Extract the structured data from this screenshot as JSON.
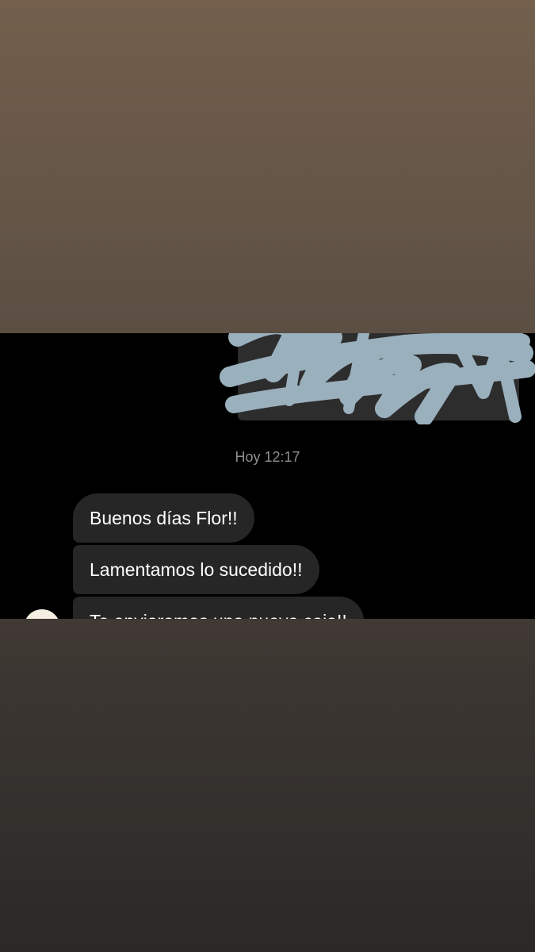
{
  "chat": {
    "timestamp": "Hoy 12:17",
    "messages": [
      {
        "text": "Buenos días Flor!!"
      },
      {
        "text": "Lamentamos lo sucedido!!"
      },
      {
        "text": "Te enviaremos una nueva caja!!"
      }
    ]
  },
  "colors": {
    "top_background": "#735f4c",
    "chat_background": "#000000",
    "bubble": "#262626",
    "scribble": "#9ab0bd",
    "bottom_background": "#2a2927"
  },
  "icons": {
    "avatar": "contact-avatar",
    "redaction": "scribble-redaction"
  }
}
